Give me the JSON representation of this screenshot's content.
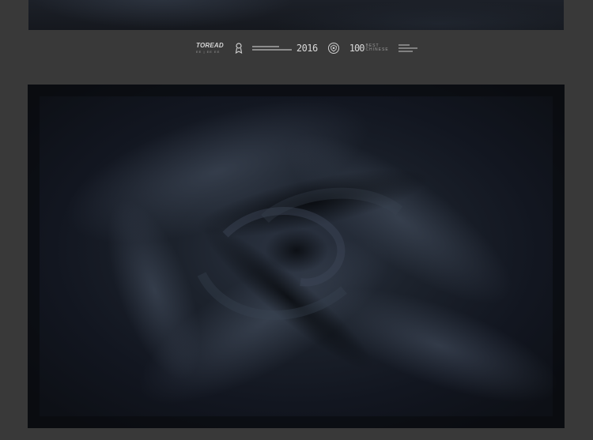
{
  "logo_strip": {
    "brand_name": "TOREAD",
    "brand_sub": "EE | EE EE",
    "year": "2016",
    "hundred": "100",
    "hundred_sub_1": "BEST",
    "hundred_sub_2": "CHINESE"
  },
  "images": {
    "top": "fabric-close-up-top",
    "main": "fabric-swirl-close-up"
  },
  "colors": {
    "background": "#393939",
    "fabric": "#141820",
    "logo_text": "#d8d8d8"
  },
  "icons": {
    "rank": "rank-ribbon-icon",
    "badge": "crest-badge-icon"
  }
}
